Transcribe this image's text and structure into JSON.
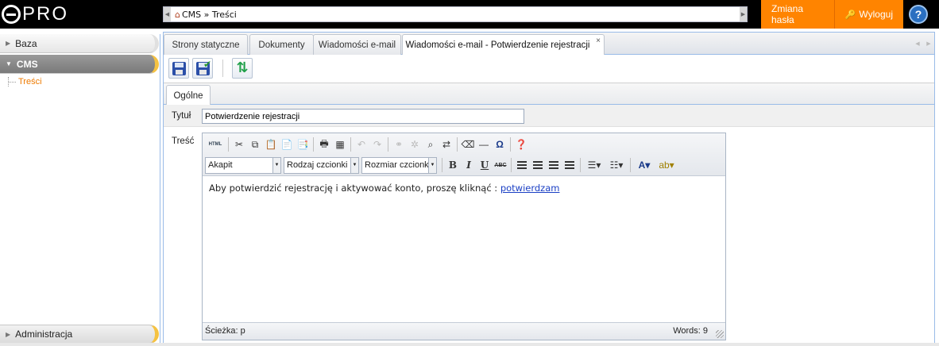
{
  "app": {
    "logo_text": "PRO"
  },
  "breadcrumb": {
    "text": "CMS » Treści"
  },
  "topnav": {
    "change_password": "Zmiana hasła",
    "logout": "Wyloguj",
    "help": "?"
  },
  "sidebar": {
    "sections": [
      {
        "label": "Baza"
      },
      {
        "label": "CMS",
        "items": [
          {
            "label": "Treści"
          }
        ]
      },
      {
        "label": "Administracja"
      }
    ]
  },
  "tabs": [
    {
      "label": "Strony statyczne"
    },
    {
      "label": "Dokumenty"
    },
    {
      "label": "Wiadomości e-mail"
    },
    {
      "label": "Wiadomości e-mail - Potwierdzenie rejestracji",
      "active": true,
      "close": "×"
    }
  ],
  "subtabs": [
    {
      "label": "Ogólne"
    }
  ],
  "form": {
    "title_label": "Tytuł",
    "title_value": "Potwierdzenie rejestracji",
    "content_label": "Treść"
  },
  "editor": {
    "html_button": "HTML",
    "paragraph_select": "Akapit",
    "font_select": "Rodzaj czcionki",
    "size_select": "Rozmiar czcionki",
    "bold": "B",
    "italic": "I",
    "underline": "U",
    "strike": "ABC",
    "content_text": "Aby potwierdzić rejestrację i aktywować konto, proszę kliknąć : ",
    "content_link": "potwierdzam",
    "status_path": "Ścieżka: p",
    "word_count": "Words: 9"
  },
  "colors": {
    "accent": "#ff8400",
    "topbar": "#000000",
    "link": "#1a3fc4",
    "tree_active": "#ee7a00"
  }
}
